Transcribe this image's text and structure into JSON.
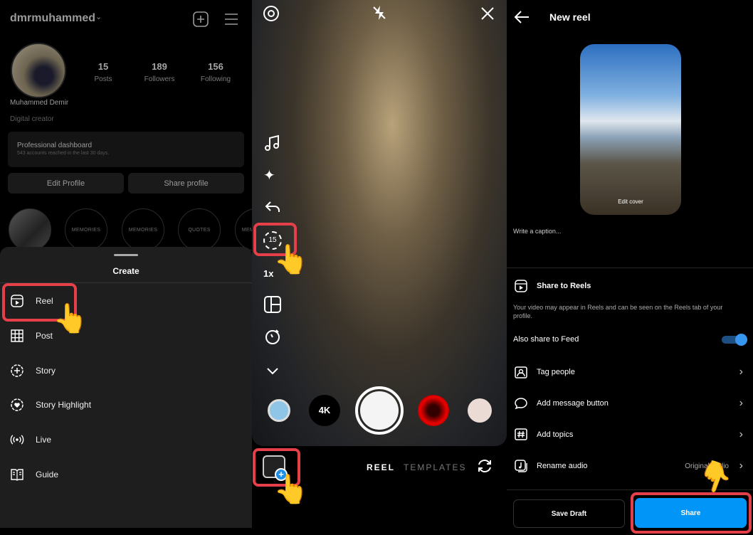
{
  "profile": {
    "username": "dmrmuhammed",
    "stats": [
      {
        "value": "15",
        "label": "Posts"
      },
      {
        "value": "189",
        "label": "Followers"
      },
      {
        "value": "156",
        "label": "Following"
      }
    ],
    "name": "Muhammed Demir",
    "category": "Digital creator",
    "dashboard": {
      "title": "Professional dashboard",
      "subtitle": "543 accounts reached in the last 30 days."
    },
    "edit_label": "Edit Profile",
    "share_label": "Share profile",
    "highlights": [
      "MEMORIES",
      "MEMORIES",
      "QUOTES",
      "MEMORIES"
    ]
  },
  "create_sheet": {
    "title": "Create",
    "items": [
      {
        "label": "Reel",
        "icon": "reel-icon"
      },
      {
        "label": "Post",
        "icon": "grid-icon"
      },
      {
        "label": "Story",
        "icon": "story-plus-icon"
      },
      {
        "label": "Story Highlight",
        "icon": "highlight-heart-icon"
      },
      {
        "label": "Live",
        "icon": "live-icon"
      },
      {
        "label": "Guide",
        "icon": "guide-icon"
      }
    ]
  },
  "camera": {
    "timer_label": "15",
    "speed_label": "1x",
    "lens_4k": "4K",
    "modes": [
      "REEL",
      "TEMPLATES"
    ],
    "active_mode": "REEL"
  },
  "new_reel": {
    "title": "New reel",
    "edit_cover": "Edit cover",
    "caption_placeholder": "Write a caption...",
    "share_to_reels": "Share to Reels",
    "share_desc": "Your video may appear in Reels and can be seen on the Reels tab of your profile.",
    "also_share_feed": "Also share to Feed",
    "also_share_feed_on": true,
    "options": [
      {
        "label": "Tag people",
        "icon": "tag-people-icon"
      },
      {
        "label": "Add message button",
        "icon": "message-icon"
      },
      {
        "label": "Add topics",
        "icon": "hashtag-icon"
      },
      {
        "label": "Rename audio",
        "icon": "audio-icon",
        "value": "Original audio"
      }
    ],
    "save_draft": "Save Draft",
    "share": "Share"
  },
  "colors": {
    "accent": "#0095f6",
    "highlight": "#e5404a",
    "toggle": "#3797f0"
  }
}
